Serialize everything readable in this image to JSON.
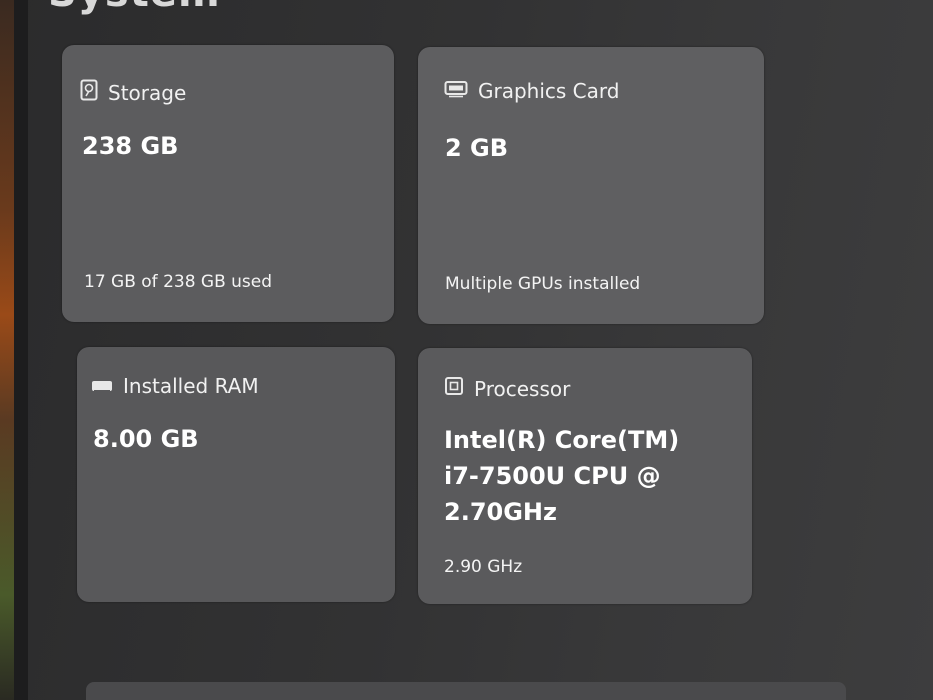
{
  "page": {
    "heading": "System"
  },
  "cards": {
    "storage": {
      "title": "Storage",
      "value": "238 GB",
      "detail": "17 GB of 238 GB used",
      "icon": "hard-drive-icon"
    },
    "graphics": {
      "title": "Graphics Card",
      "value": "2 GB",
      "detail": "Multiple GPUs installed",
      "icon": "graphics-card-icon"
    },
    "ram": {
      "title": "Installed RAM",
      "value": "8.00 GB",
      "icon": "memory-icon"
    },
    "processor": {
      "title": "Processor",
      "value_line1": "Intel(R) Core(TM)",
      "value_line2": "i7-7500U CPU @",
      "value_line3": "2.70GHz",
      "detail": "2.90 GHz",
      "icon": "processor-icon"
    }
  },
  "colors": {
    "background": "#323233",
    "card": "#5c5c5e",
    "text": "#ffffff"
  }
}
